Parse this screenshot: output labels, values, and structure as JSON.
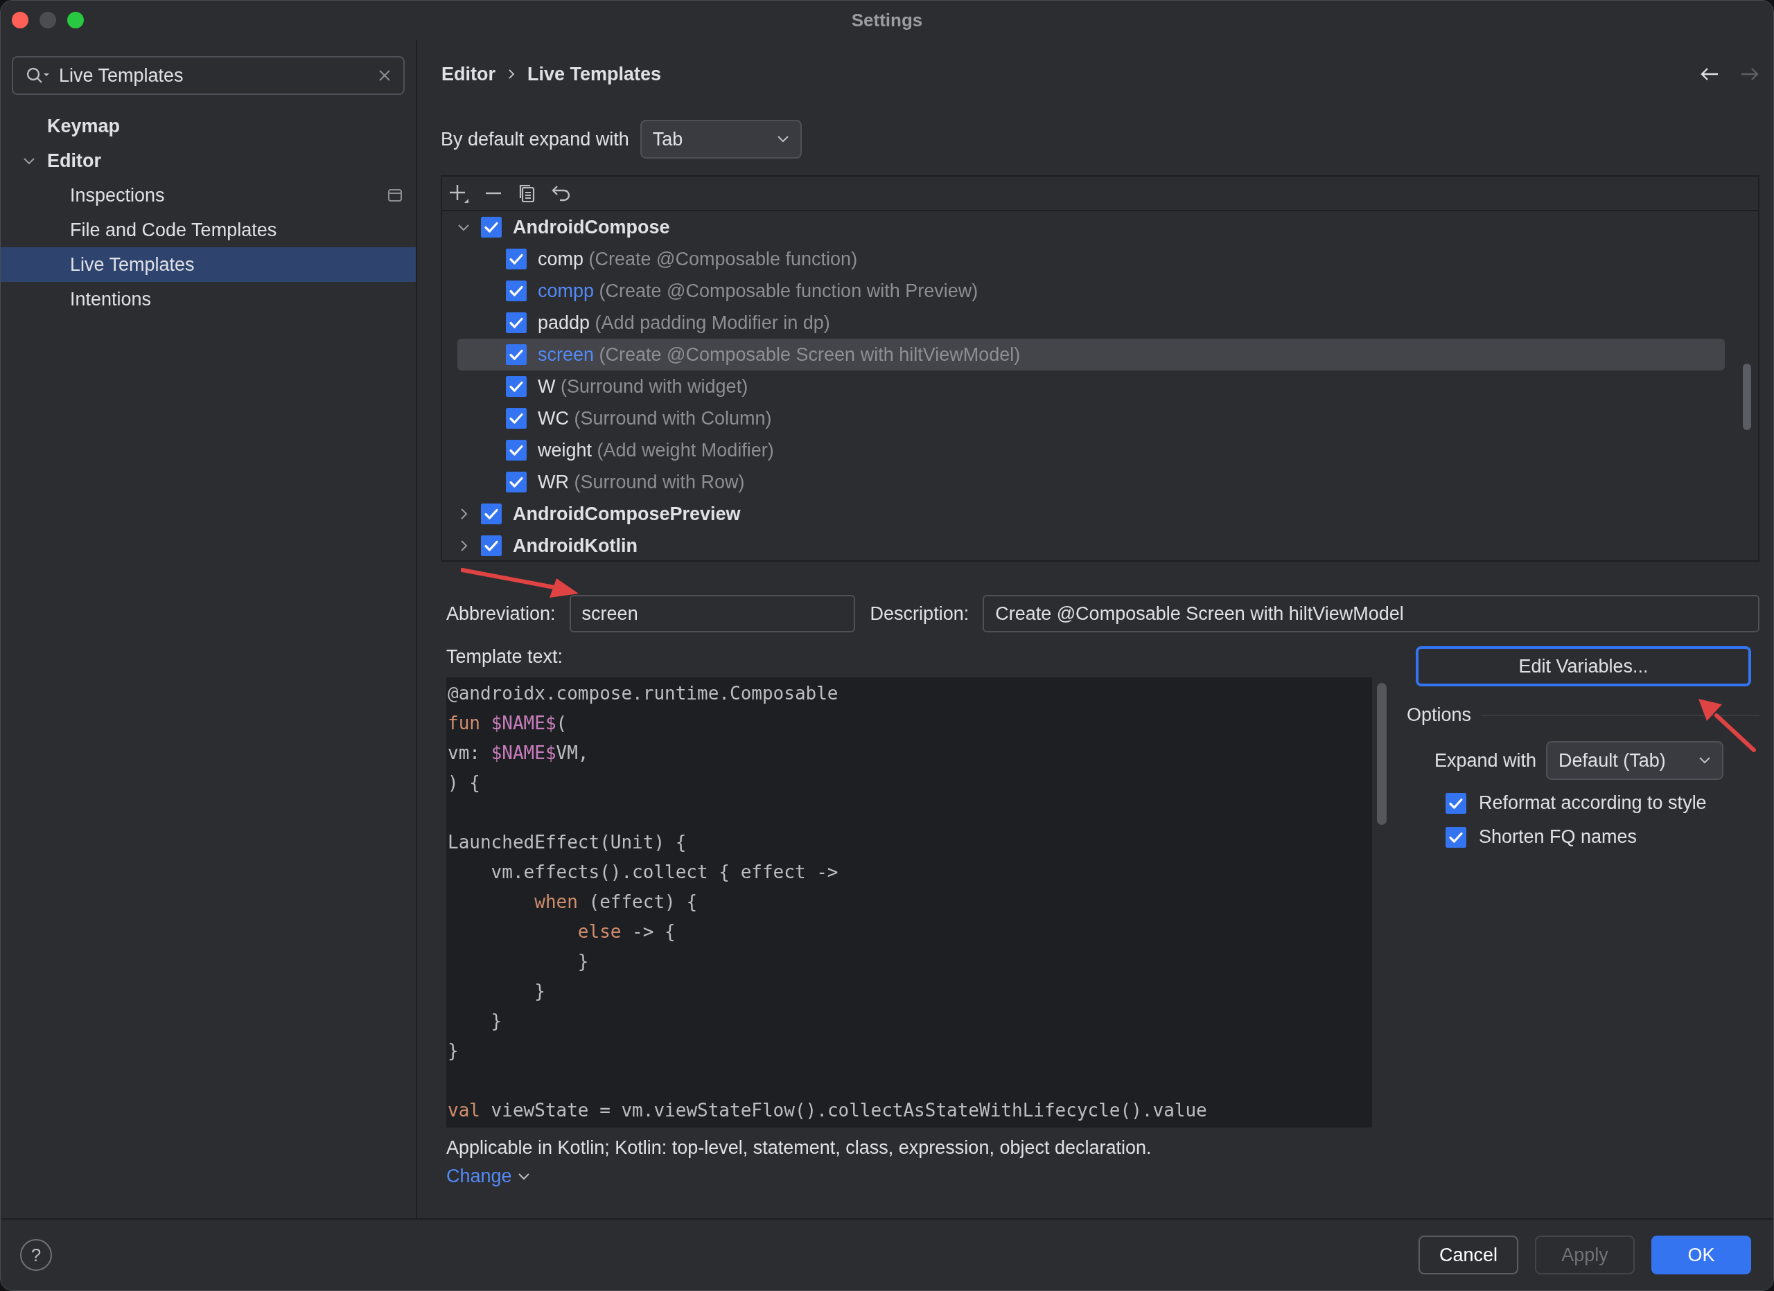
{
  "window": {
    "title": "Settings"
  },
  "search": {
    "value": "Live Templates"
  },
  "sidebar": {
    "items": [
      {
        "label": "Keymap",
        "kind": "top",
        "selected": false
      },
      {
        "label": "Editor",
        "kind": "group",
        "expanded": true,
        "selected": false,
        "children": [
          {
            "label": "Inspections",
            "project_level": true,
            "selected": false
          },
          {
            "label": "File and Code Templates",
            "project_level": false,
            "selected": false
          },
          {
            "label": "Live Templates",
            "project_level": false,
            "selected": true
          },
          {
            "label": "Intentions",
            "project_level": false,
            "selected": false
          }
        ]
      }
    ]
  },
  "breadcrumb": [
    "Editor",
    "Live Templates"
  ],
  "navigation": {
    "back_enabled": true,
    "forward_enabled": false
  },
  "default_expand": {
    "label": "By default expand with",
    "value": "Tab"
  },
  "template_groups": [
    {
      "name": "AndroidCompose",
      "checked": true,
      "expanded": true,
      "templates": [
        {
          "abbreviation": "comp",
          "description": "(Create @Composable function)",
          "checked": true,
          "modified": false,
          "selected": false
        },
        {
          "abbreviation": "compp",
          "description": "(Create @Composable function with Preview)",
          "checked": true,
          "modified": true,
          "selected": false
        },
        {
          "abbreviation": "paddp",
          "description": "(Add padding Modifier in dp)",
          "checked": true,
          "modified": false,
          "selected": false
        },
        {
          "abbreviation": "screen",
          "description": "(Create @Composable Screen with hiltViewModel)",
          "checked": true,
          "modified": true,
          "selected": true
        },
        {
          "abbreviation": "W",
          "description": "(Surround with widget)",
          "checked": true,
          "modified": false,
          "selected": false
        },
        {
          "abbreviation": "WC",
          "description": "(Surround with Column)",
          "checked": true,
          "modified": false,
          "selected": false
        },
        {
          "abbreviation": "weight",
          "description": "(Add weight Modifier)",
          "checked": true,
          "modified": false,
          "selected": false
        },
        {
          "abbreviation": "WR",
          "description": "(Surround with Row)",
          "checked": true,
          "modified": false,
          "selected": false
        }
      ]
    },
    {
      "name": "AndroidComposePreview",
      "checked": true,
      "expanded": false
    },
    {
      "name": "AndroidKotlin",
      "checked": true,
      "expanded": false
    }
  ],
  "abbreviation": {
    "label": "Abbreviation:",
    "value": "screen"
  },
  "description": {
    "label": "Description:",
    "value": "Create @Composable Screen with hiltViewModel"
  },
  "template_text": {
    "label": "Template text:",
    "lines": [
      {
        "kind": "code",
        "segments": [
          {
            "text": "@androidx.compose.runtime.Composable",
            "kind": "plain"
          }
        ]
      },
      {
        "kind": "code",
        "segments": [
          {
            "text": "fun ",
            "kind": "keyword"
          },
          {
            "text": "$NAME$",
            "kind": "variable"
          },
          {
            "text": "(",
            "kind": "plain"
          }
        ]
      },
      {
        "kind": "code",
        "segments": [
          {
            "text": "vm: ",
            "kind": "plain"
          },
          {
            "text": "$NAME$",
            "kind": "variable"
          },
          {
            "text": "VM,",
            "kind": "plain"
          }
        ]
      },
      {
        "kind": "code",
        "segments": [
          {
            "text": ") {",
            "kind": "plain"
          }
        ]
      },
      {
        "kind": "blank"
      },
      {
        "kind": "code",
        "segments": [
          {
            "text": "LaunchedEffect(Unit) {",
            "kind": "plain"
          }
        ]
      },
      {
        "kind": "code",
        "segments": [
          {
            "text": "    vm.effects().collect { effect ->",
            "kind": "plain"
          }
        ]
      },
      {
        "kind": "code",
        "segments": [
          {
            "text": "        when",
            "kind": "keyword"
          },
          {
            "text": " (effect) {",
            "kind": "plain"
          }
        ]
      },
      {
        "kind": "code",
        "segments": [
          {
            "text": "            else",
            "kind": "keyword"
          },
          {
            "text": " -> {",
            "kind": "plain"
          }
        ]
      },
      {
        "kind": "code",
        "segments": [
          {
            "text": "            }",
            "kind": "plain"
          }
        ]
      },
      {
        "kind": "code",
        "segments": [
          {
            "text": "        }",
            "kind": "plain"
          }
        ]
      },
      {
        "kind": "code",
        "segments": [
          {
            "text": "    }",
            "kind": "plain"
          }
        ]
      },
      {
        "kind": "code",
        "segments": [
          {
            "text": "}",
            "kind": "plain"
          }
        ]
      },
      {
        "kind": "blank"
      },
      {
        "kind": "code",
        "segments": [
          {
            "text": "val",
            "kind": "keyword"
          },
          {
            "text": " viewState = vm.viewStateFlow().collectAsStateWithLifecycle().value",
            "kind": "plain"
          }
        ]
      }
    ]
  },
  "applicable": "Applicable in Kotlin; Kotlin: top-level, statement, class, expression, object declaration.",
  "change_link": "Change",
  "edit_variables_button": "Edit Variables...",
  "options": {
    "title": "Options",
    "expand_with": {
      "label": "Expand with",
      "value": "Default (Tab)"
    },
    "checkboxes": [
      {
        "label": "Reformat according to style",
        "checked": true
      },
      {
        "label": "Shorten FQ names",
        "checked": true
      }
    ]
  },
  "help": "?",
  "buttons": [
    {
      "label": "Cancel",
      "kind": "secondary"
    },
    {
      "label": "Apply",
      "kind": "disabled"
    },
    {
      "label": "OK",
      "kind": "primary"
    }
  ]
}
